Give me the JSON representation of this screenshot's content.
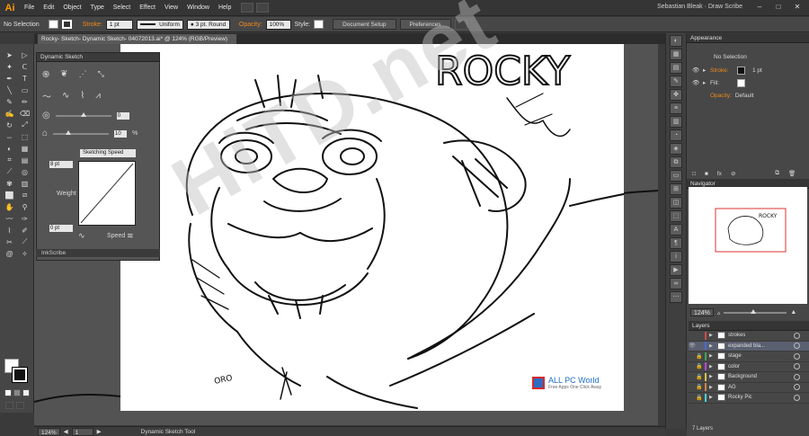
{
  "menubar": {
    "logo": "Ai",
    "items": [
      "File",
      "Edit",
      "Object",
      "Type",
      "Select",
      "Effect",
      "View",
      "Window",
      "Help"
    ],
    "user_workspace": "Sebastian Bleak · Draw Scribe"
  },
  "controlbar": {
    "selection": "No Selection",
    "stroke_label": "Stroke:",
    "stroke_weight": "1 pt",
    "profile": "Uniform",
    "brush": "3 pt. Round",
    "opacity_label": "Opacity:",
    "opacity_value": "100%",
    "style_label": "Style:",
    "doc_setup": "Document Setup",
    "preferences": "Preferences"
  },
  "document": {
    "tab_title": "Rocky- Sketch- Dynamic Sketch- 04072013.ai* @ 124% (RGB/Preview)"
  },
  "sketch_panel": {
    "title": "Dynamic Sketch",
    "value_1": "0",
    "value_2": "10",
    "value_2_unit": "%",
    "speed_select": "Sketching Speed",
    "top_value": "8 pt",
    "bottom_value": "0 pt",
    "weight_label": "Weight",
    "speed_label": "Speed"
  },
  "inkscribe_tab": "InkScribe",
  "appearance": {
    "tab": "Appearance",
    "selection": "No Selection",
    "stroke_label": "Stroke:",
    "stroke_value": "1 pt",
    "fill_label": "Fill:",
    "opacity_label": "Opacity:",
    "opacity_value": "Default",
    "footer_icons": [
      "square-icon",
      "square-icon",
      "fx-icon",
      "clear-icon",
      "duplicate-icon",
      "delete-icon"
    ]
  },
  "navigator": {
    "tab": "Navigator",
    "zoom": "124%"
  },
  "layers": {
    "tab": "Layers",
    "count": "7 Layers",
    "rows": [
      {
        "name": "strokes",
        "color": "#d14a4a",
        "selected": false,
        "eye": "",
        "lock": ""
      },
      {
        "name": "expanded bla...",
        "color": "#4a6bd1",
        "selected": true,
        "eye": "👁",
        "lock": ""
      },
      {
        "name": "stage",
        "color": "#3aa856",
        "selected": false,
        "eye": "",
        "lock": "🔒"
      },
      {
        "name": "color",
        "color": "#b64ad1",
        "selected": false,
        "eye": "",
        "lock": "🔒"
      },
      {
        "name": "Background",
        "color": "#d1c24a",
        "selected": false,
        "eye": "",
        "lock": "🔒"
      },
      {
        "name": "AG",
        "color": "#d1844a",
        "selected": false,
        "eye": "",
        "lock": "🔒"
      },
      {
        "name": "Rocky Pic",
        "color": "#4ad1d1",
        "selected": false,
        "eye": "",
        "lock": "🔒"
      }
    ]
  },
  "statusbar": {
    "zoom": "124%",
    "page": "1",
    "tool": "Dynamic Sketch Tool"
  },
  "canvas": {
    "title_text": "ROCKY",
    "signature": "ORO"
  },
  "watermark": {
    "text": "HiTD.net",
    "brand": "ALL PC World",
    "tagline": "Free Apps One Click Away"
  }
}
